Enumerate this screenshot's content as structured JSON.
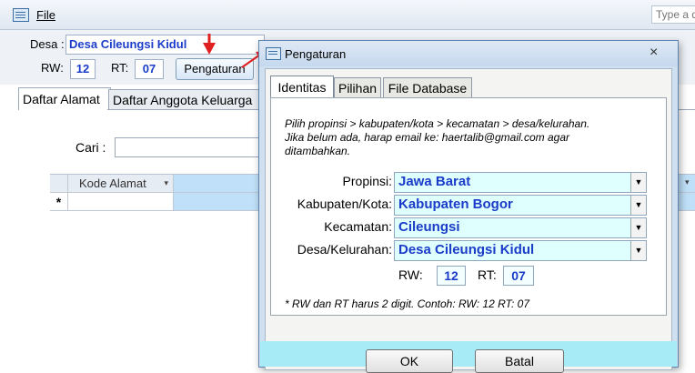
{
  "app": {
    "file_menu": "File",
    "search_placeholder": "Type a q"
  },
  "form": {
    "desa_label": "Desa :",
    "desa_value": "Desa Cileungsi Kidul",
    "rw_label": "RW:",
    "rw_value": "12",
    "rt_label": "RT:",
    "rt_value": "07",
    "pengaturan_button": "Pengaturan",
    "tabs": [
      "Daftar Alamat",
      "Daftar Anggota Keluarga"
    ],
    "cari_label": "Cari :",
    "table": {
      "column_header": "Kode Alamat",
      "new_row_marker": "*"
    }
  },
  "dialog": {
    "title": "Pengaturan",
    "close_glyph": "×",
    "tabs": [
      "Identitas",
      "Pilihan",
      "File Database"
    ],
    "instructions": "Pilih propinsi > kabupaten/kota > kecamatan > desa/kelurahan.\nJika belum ada, harap email ke: haertalib@gmail.com agar\nditambahkan.",
    "fields": [
      {
        "label": "Propinsi:",
        "value": "Jawa Barat"
      },
      {
        "label": "Kabupaten/Kota:",
        "value": "Kabupaten Bogor"
      },
      {
        "label": "Kecamatan:",
        "value": "Cileungsi"
      },
      {
        "label": "Desa/Kelurahan:",
        "value": "Desa Cileungsi Kidul"
      }
    ],
    "rw_label": "RW:",
    "rw_value": "12",
    "rt_label": "RT:",
    "rt_value": "07",
    "note": "* RW dan RT harus 2 digit. Contoh: RW: 12 RT: 07",
    "ok_button": "OK",
    "cancel_button": "Batal"
  },
  "colors": {
    "field_text": "#1a3cc8",
    "combo_bg": "#dfffff",
    "dialog_footer": "#a7ebf7",
    "arrow_red": "#e02020"
  }
}
